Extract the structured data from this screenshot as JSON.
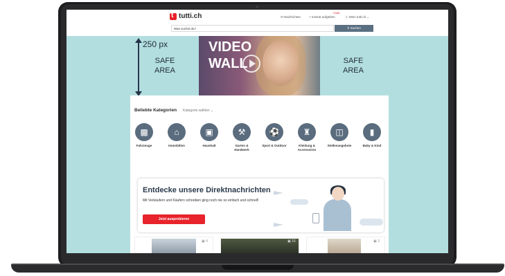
{
  "site": {
    "logo": "tutti.ch",
    "nav": {
      "messages": "Nachrichten",
      "post_ad": "Inserat aufgeben",
      "post_ad_badge": "Gratis",
      "account": "Mein tutti.ch"
    },
    "search_placeholder": "Was suchst du?",
    "search_button": "Suchen"
  },
  "annotations": {
    "height": "250 px",
    "safe_left": "SAFE AREA",
    "safe_right": "SAFE AREA"
  },
  "video": {
    "label_line1": "VIDEO",
    "label_line2": "WALL"
  },
  "categories": {
    "title": "Beliebte Kategorien",
    "select": "Kategorie wählen",
    "items": [
      {
        "label": "Fahrzeuge",
        "icon": "car-icon"
      },
      {
        "label": "Immobilien",
        "icon": "house-icon"
      },
      {
        "label": "Haushalt",
        "icon": "armchair-icon"
      },
      {
        "label": "Garten & Handwerk",
        "icon": "tools-icon"
      },
      {
        "label": "Sport & Outdoor",
        "icon": "ball-icon"
      },
      {
        "label": "Kleidung & Accessoires",
        "icon": "shirt-icon"
      },
      {
        "label": "Stellenangebote",
        "icon": "briefcase-icon"
      },
      {
        "label": "Baby & Kind",
        "icon": "bottle-icon"
      }
    ]
  },
  "promo": {
    "title": "Entdecke unsere Direktnachrichten",
    "text": "Mit Verkäufern und Käufern schreiben ging noch nie so einfach und schnell!",
    "button": "Jetzt ausprobieren"
  },
  "listing_counts": [
    "4",
    "16",
    "3"
  ],
  "colors": {
    "accent": "#e8232b",
    "category_icon": "#5a6c7e",
    "safe_area": "#b3dedf"
  }
}
